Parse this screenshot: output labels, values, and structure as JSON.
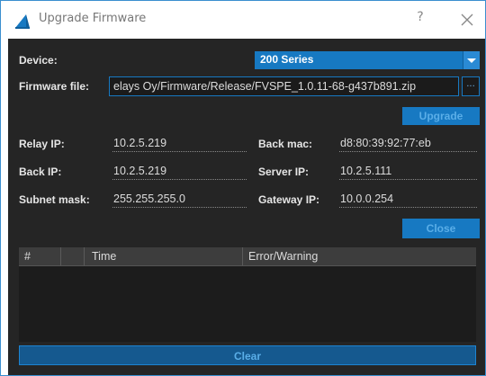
{
  "window": {
    "title": "Upgrade Firmware",
    "help_label": "?"
  },
  "form": {
    "device_label": "Device:",
    "device_value": "200 Series",
    "firmware_label": "Firmware file:",
    "firmware_value": "elays Oy/Firmware/Release/FVSPE_1.0.11-68-g437b891.zip",
    "browse_label": "...",
    "upgrade_label": "Upgrade"
  },
  "info": {
    "relay_ip_label": "Relay IP:",
    "relay_ip_value": "10.2.5.219",
    "back_mac_label": "Back mac:",
    "back_mac_value": "d8:80:39:92:77:eb",
    "back_ip_label": "Back IP:",
    "back_ip_value": "10.2.5.219",
    "server_ip_label": "Server IP:",
    "server_ip_value": "10.2.5.111",
    "subnet_label": "Subnet mask:",
    "subnet_value": "255.255.255.0",
    "gateway_label": "Gateway IP:",
    "gateway_value": "10.0.0.254",
    "close_label": "Close"
  },
  "log_table": {
    "columns": [
      "#",
      "",
      "Time",
      "Error/Warning"
    ],
    "rows": []
  },
  "clear_label": "Clear",
  "colors": {
    "accent": "#1779c2",
    "background": "#252525",
    "button_text": "#5aaee8"
  }
}
